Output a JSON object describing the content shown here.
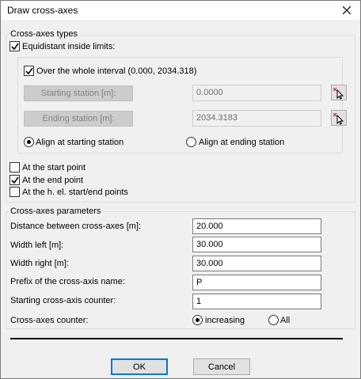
{
  "window": {
    "title": "Draw cross-axes"
  },
  "types": {
    "legend": "Cross-axes types",
    "equidistant_label": "Equidistant inside limits:",
    "whole_interval_label": "Over the whole interval (0.000, 2034.318)",
    "starting_station_button": "Starting station [m]:",
    "starting_station_value": "0.0000",
    "ending_station_button": "Ending station [m]:",
    "ending_station_value": "2034.3183",
    "align_start_label": "Align at starting station",
    "align_end_label": "Align at ending station",
    "start_point_label": "At the start point",
    "end_point_label": "At the end point",
    "hel_label": "At the h. el. start/end points"
  },
  "params": {
    "legend": "Cross-axes parameters",
    "distance_label": "Distance between cross-axes [m]:",
    "distance_value": "20.000",
    "width_left_label": "Width left [m]:",
    "width_left_value": "30.000",
    "width_right_label": "Width right [m]:",
    "width_right_value": "30.000",
    "prefix_label": "Prefix of the cross-axis name:",
    "prefix_value": "P",
    "counter_start_label": "Starting cross-axis counter:",
    "counter_start_value": "1",
    "counter_label": "Cross-axes counter:",
    "increasing_label": "increasing",
    "all_label": "All"
  },
  "buttons": {
    "ok": "OK",
    "cancel": "Cancel"
  },
  "state": {
    "equidistant": true,
    "whole_interval": true,
    "align": "start",
    "start_point": false,
    "end_point": true,
    "hel_points": false,
    "counter": "increasing"
  },
  "icons": {
    "close": "close-icon",
    "pick": "pick-from-drawing-icon",
    "check": "check-icon"
  },
  "colors": {
    "default_button_border": "#0078d7",
    "disabled_text": "#838383"
  }
}
